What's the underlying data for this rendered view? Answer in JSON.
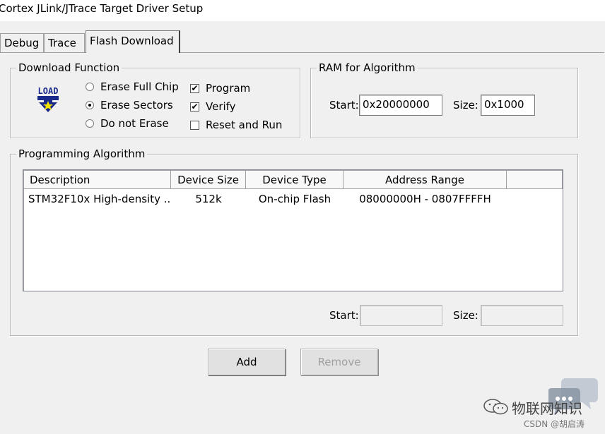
{
  "window": {
    "title": "Cortex JLink/JTrace Target Driver Setup"
  },
  "tabs": [
    {
      "label": "Debug",
      "active": false
    },
    {
      "label": "Trace",
      "active": false
    },
    {
      "label": "Flash Download",
      "active": true
    }
  ],
  "download_function": {
    "label": "Download Function",
    "icon": "load-icon",
    "icon_text": "LOAD",
    "erase_options": [
      {
        "label": "Erase Full Chip",
        "selected": false
      },
      {
        "label": "Erase Sectors",
        "selected": true
      },
      {
        "label": "Do not Erase",
        "selected": false
      }
    ],
    "checkboxes": [
      {
        "label": "Program",
        "checked": true
      },
      {
        "label": "Verify",
        "checked": true
      },
      {
        "label": "Reset and Run",
        "checked": false
      }
    ]
  },
  "ram_for_algorithm": {
    "label": "RAM for Algorithm",
    "start_label": "Start:",
    "start_value": "0x20000000",
    "size_label": "Size:",
    "size_value": "0x1000"
  },
  "programming_algorithm": {
    "label": "Programming Algorithm",
    "columns": [
      "Description",
      "Device Size",
      "Device Type",
      "Address Range"
    ],
    "rows": [
      {
        "description": "STM32F10x High-density ...",
        "device_size": "512k",
        "device_type": "On-chip Flash",
        "address_range": "08000000H - 0807FFFFH"
      }
    ],
    "start_label": "Start:",
    "start_value": "",
    "size_label": "Size:",
    "size_value": ""
  },
  "buttons": {
    "add": "Add",
    "remove": "Remove"
  },
  "watermark": {
    "brand": "物联网知识",
    "credit": "CSDN @胡启涛"
  }
}
